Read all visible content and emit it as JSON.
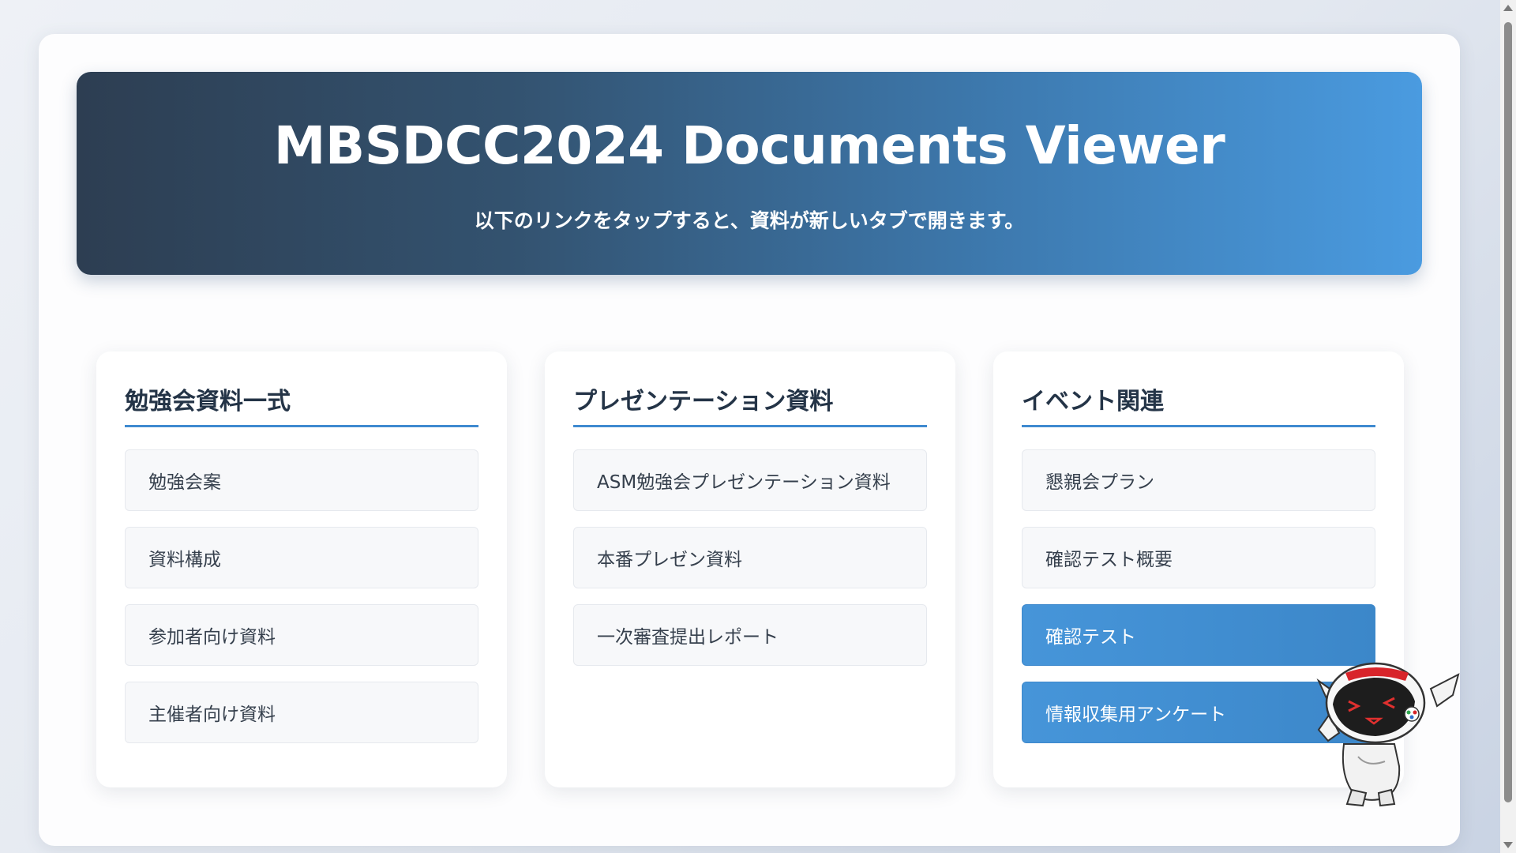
{
  "header": {
    "title": "MBSDCC2024 Documents Viewer",
    "subtitle": "以下のリンクをタップすると、資料が新しいタブで開きます。"
  },
  "sections": [
    {
      "heading": "勉強会資料一式",
      "links": [
        "勉強会案",
        "資料構成",
        "参加者向け資料",
        "主催者向け資料"
      ]
    },
    {
      "heading": "プレゼンテーション資料",
      "links": [
        "ASM勉強会プレゼンテーション資料",
        "本番プレゼン資料",
        "一次審査提出レポート"
      ]
    },
    {
      "heading": "イベント関連",
      "links": [
        "懇親会プラン",
        "確認テスト概要",
        "確認テスト",
        "情報収集用アンケート"
      ]
    }
  ],
  "highlighted_links": [
    "確認テスト",
    "情報収集用アンケート"
  ],
  "colors": {
    "hero_gradient_start": "#2d3e52",
    "hero_gradient_end": "#4a9be0",
    "accent": "#3f8ad0",
    "heading_text": "#243447"
  },
  "mascot": {
    "icon": "robot-mascot-icon"
  }
}
